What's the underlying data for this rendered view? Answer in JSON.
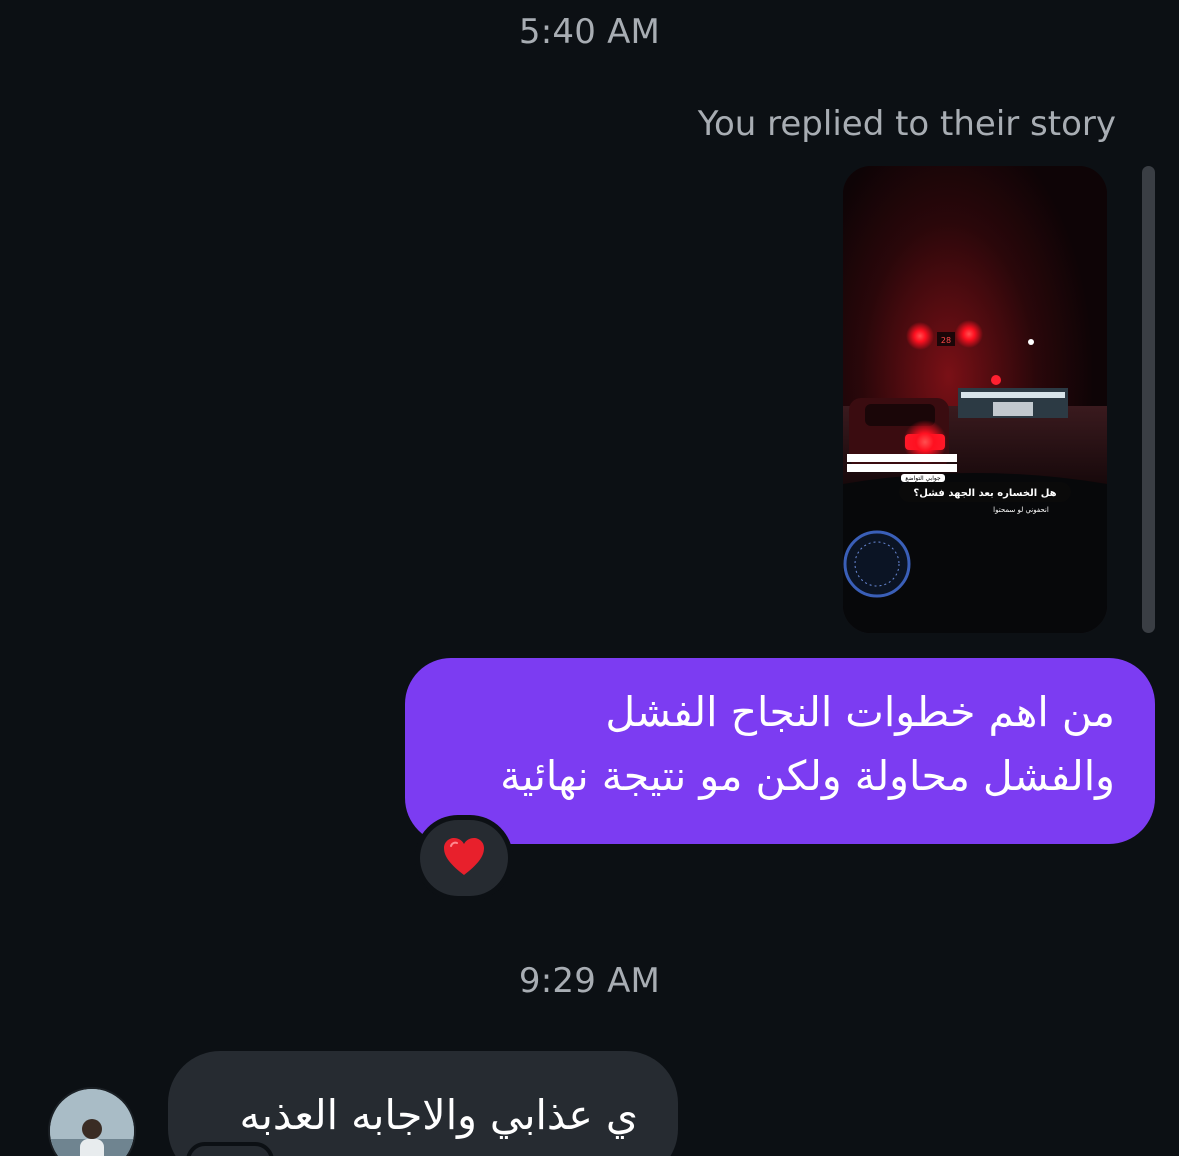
{
  "thread": {
    "timestamp_1": "5:40 AM",
    "story_reply_note": "You replied to their story",
    "outgoing_message": {
      "line_1": "من اهم خطوات النجاح الفشل",
      "line_2": "والفشل محاولة ولكن مو نتيجة نهائية"
    },
    "reaction": "heart",
    "timestamp_2": "9:29 AM",
    "incoming_message": "ي عذابي والاجابه العذبه"
  },
  "story_preview": {
    "question_text": "هل الخساره بعد الجهد فشل؟",
    "caption_text": "انحفوني لو سمحتوا",
    "sticker_text": "جوابي التواضع",
    "signal_number": "28"
  },
  "colors": {
    "background": "#0c1014",
    "outgoing_bubble": "#7c3cf2",
    "incoming_bubble": "#262b31",
    "secondary_text": "#a8adb3",
    "heart": "#e8202c"
  }
}
